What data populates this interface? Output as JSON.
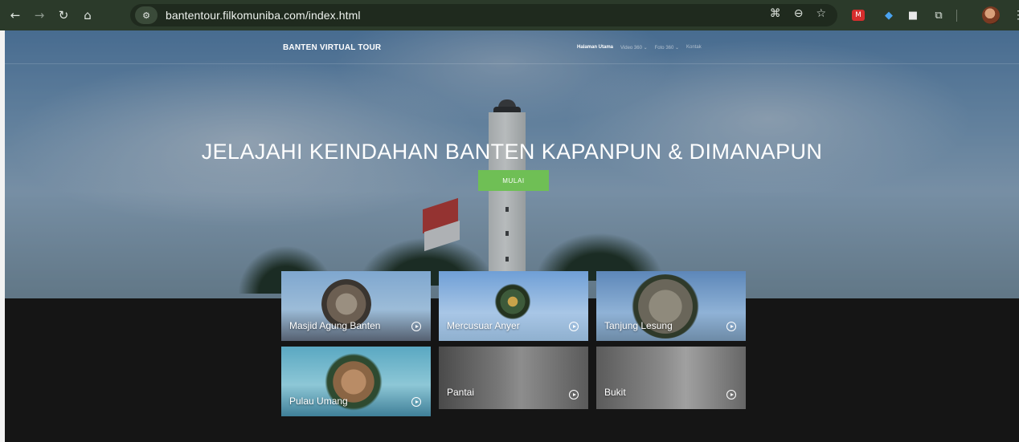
{
  "browser": {
    "url": "bantentour.filkomuniba.com/index.html",
    "icons": [
      "back-icon",
      "forward-icon",
      "reload-icon",
      "home-icon",
      "site-info-icon",
      "translate-icon",
      "zoom-icon",
      "bookmark-star-icon",
      "extension-icon",
      "puzzle-icon",
      "profile-avatar",
      "menu-icon"
    ]
  },
  "site": {
    "brand": "BANTEN VIRTUAL TOUR",
    "nav": {
      "home": "Halaman Utama",
      "video": "Video 360 ⌄",
      "photo": "Foto 360 ⌄",
      "contact": "Kontak"
    },
    "hero": {
      "title": "JELAJAHI KEINDAHAN BANTEN KAPANPUN & DIMANAPUN",
      "button": "MULAI"
    },
    "cards": [
      {
        "title": "Masjid Agung Banten"
      },
      {
        "title": "Mercusuar Anyer"
      },
      {
        "title": "Tanjung Lesung"
      },
      {
        "title": "Pulau Umang"
      },
      {
        "title": "Pantai"
      },
      {
        "title": "Bukit"
      }
    ]
  },
  "colors": {
    "accent_green": "#6fbf55",
    "page_dark": "#151515",
    "browser_chrome": "#2b3a2a"
  }
}
